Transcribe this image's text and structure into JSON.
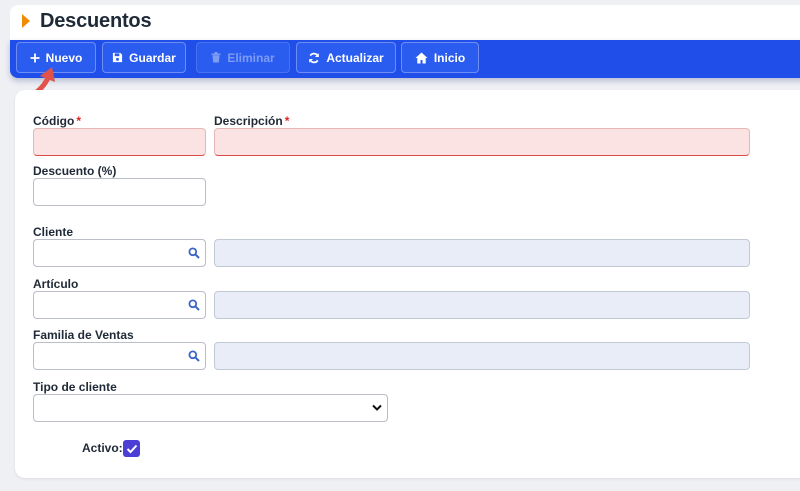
{
  "page": {
    "title": "Descuentos"
  },
  "toolbar": {
    "nuevo": "Nuevo",
    "guardar": "Guardar",
    "eliminar": "Eliminar",
    "actualizar": "Actualizar",
    "inicio": "Inicio"
  },
  "form": {
    "codigo": {
      "label": "Código",
      "required_mark": "*",
      "value": ""
    },
    "descripcion": {
      "label": "Descripción",
      "required_mark": "*",
      "value": ""
    },
    "descuento": {
      "label": "Descuento (%)",
      "value": ""
    },
    "cliente": {
      "label": "Cliente",
      "value": "",
      "description": ""
    },
    "articulo": {
      "label": "Artículo",
      "value": "",
      "description": ""
    },
    "familia": {
      "label": "Familia de Ventas",
      "value": "",
      "description": ""
    },
    "tipo_cliente": {
      "label": "Tipo de cliente",
      "selected": ""
    },
    "activo": {
      "label": "Activo:",
      "checked": true
    }
  },
  "icons": {
    "title": "caret-right-icon",
    "nuevo": "plus-icon",
    "guardar": "floppy-disk-icon",
    "eliminar": "trash-icon",
    "actualizar": "refresh-icon",
    "inicio": "home-icon",
    "lookup": "search-icon",
    "select": "chevron-down-icon",
    "checkbox": "check-icon",
    "annotation": "curved-arrow-icon"
  },
  "colors": {
    "toolbar": "#1f4fe8",
    "accent_title": "#f08a00",
    "required_bg": "#fbe3e3",
    "required_border": "#d94a4a",
    "readonly_bg": "#e8edf8",
    "checkbox": "#4b3fd6",
    "annotation_arrow": "#e0524a"
  }
}
